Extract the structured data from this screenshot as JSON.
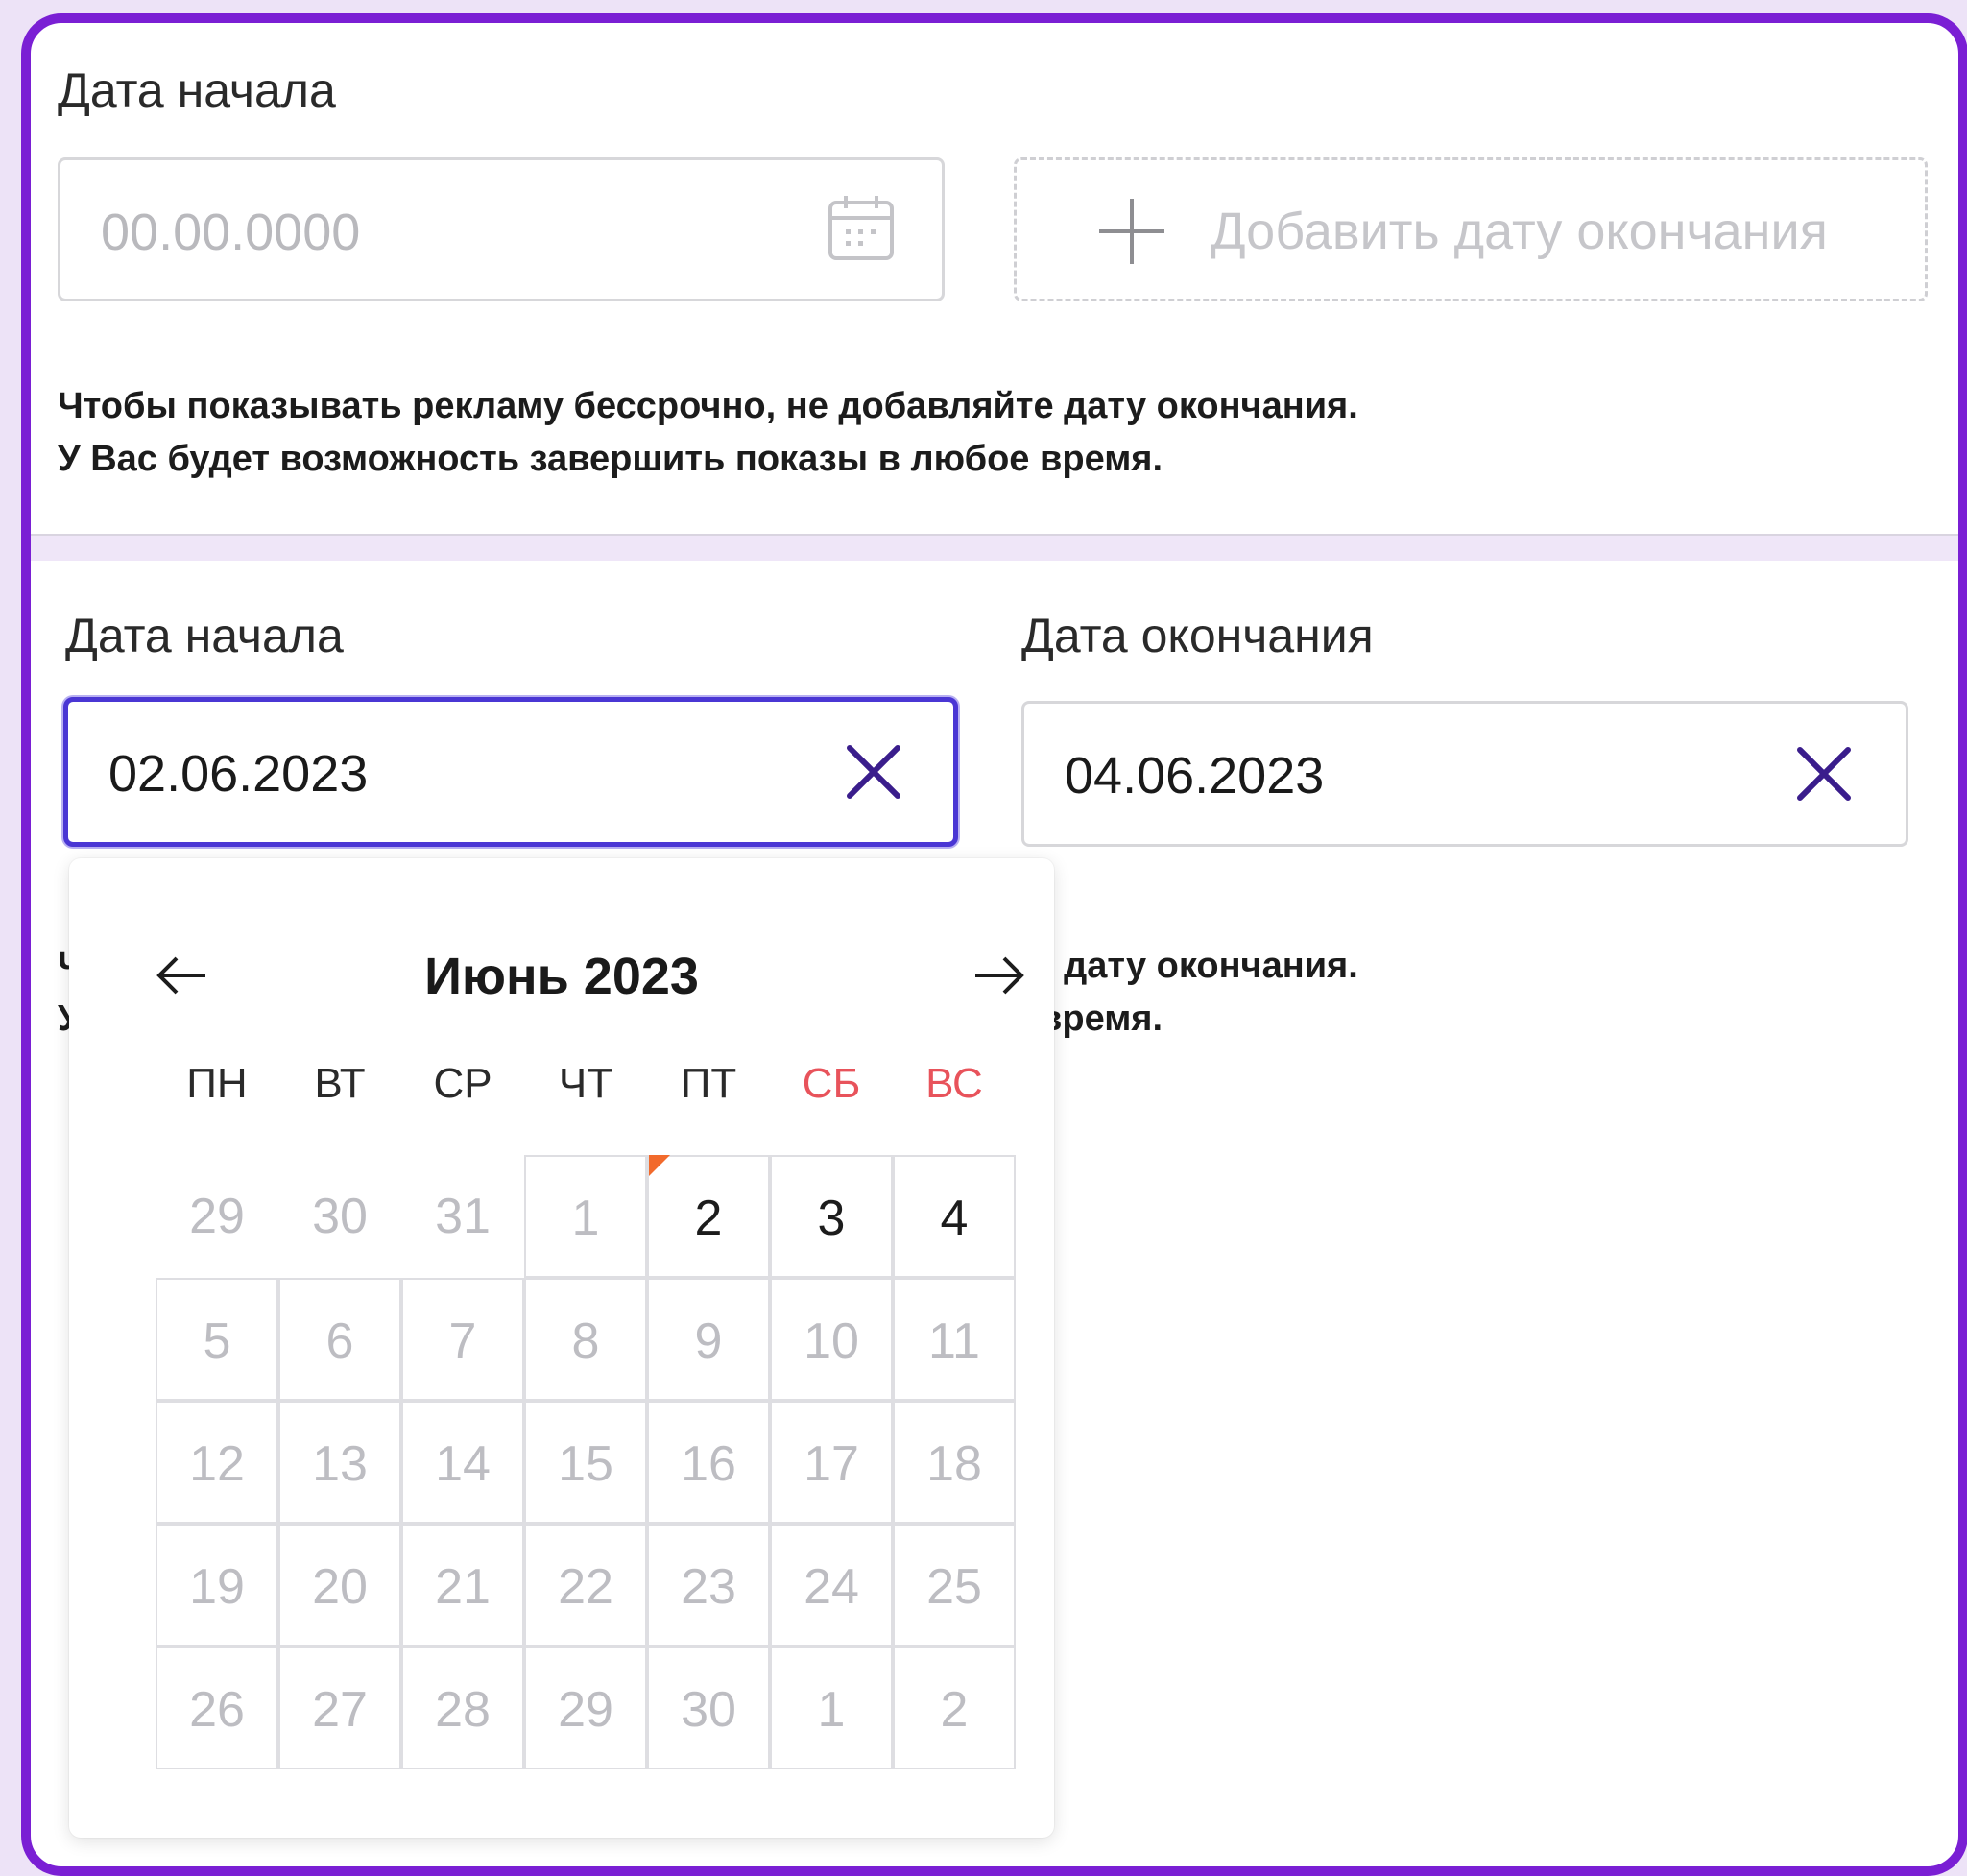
{
  "top": {
    "start_label": "Дата начала",
    "start_placeholder": "00.00.0000",
    "add_end_label": "Добавить дату окончания",
    "hint_line1": "Чтобы показывать рекламу бессрочно, не добавляйте дату окончания.",
    "hint_line2": "У Вас будет возможность завершить показы в любое время."
  },
  "bottom": {
    "start_label": "Дата начала",
    "start_value": "02.06.2023",
    "end_label": "Дата окончания",
    "end_value": "04.06.2023",
    "hint_line1": "Чтобы показывать рекламу бессрочно, не добавляйте дату окончания.",
    "hint_line2": "У Вас будет возможность завершить показы в любое время."
  },
  "calendar": {
    "month_title": "Июнь 2023",
    "weekdays": [
      "ПН",
      "ВТ",
      "СР",
      "ЧТ",
      "ПТ",
      "СБ",
      "ВС"
    ],
    "weeks": [
      [
        "29",
        "30",
        "31",
        "1",
        "2",
        "3",
        "4"
      ],
      [
        "5",
        "6",
        "7",
        "8",
        "9",
        "10",
        "11"
      ],
      [
        "12",
        "13",
        "14",
        "15",
        "16",
        "17",
        "18"
      ],
      [
        "19",
        "20",
        "21",
        "22",
        "23",
        "24",
        "25"
      ],
      [
        "26",
        "27",
        "28",
        "29",
        "30",
        "1",
        "2"
      ]
    ]
  },
  "colors": {
    "frame": "#7a1fd4",
    "focus_border": "#4a36d4",
    "clear_icon": "#3a1d8c",
    "weekend": "#e8535b",
    "today_marker": "#f26a2c"
  }
}
